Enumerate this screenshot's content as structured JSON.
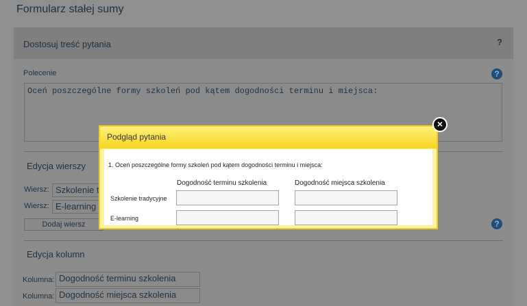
{
  "page": {
    "title": "Formularz stałej sumy"
  },
  "panel": {
    "header_title": "Dostosuj treść pytania",
    "header_help": "?",
    "polecenie_label": "Polecenie",
    "help_icon": "?",
    "polecenie_value": "Oceń poszczególne formy szkoleń pod kątem dogodności terminu i miejsca:"
  },
  "rows_section": {
    "title": "Edycja wierszy",
    "row_label": "Wiersz:",
    "rows": [
      "Szkolenie tradycyjne",
      "E-learning"
    ],
    "add_button": "Dodaj wiersz"
  },
  "columns_section": {
    "title": "Edycja kolumn",
    "column_label": "Kolumna:",
    "columns": [
      "Dogodność terminu szkolenia",
      "Dogodność miejsca szkolenia"
    ]
  },
  "modal": {
    "title": "Podgląd pytania",
    "question": "1. Oceń poszczególne formy szkoleń pod kątem dogodności terminu i miejsca:",
    "col_headers": [
      "Dogodność terminu szkolenia",
      "Dogodność miejsca szkolenia"
    ],
    "rows": [
      "Szkolenie tradycyjne",
      "E-learning"
    ],
    "close_icon": "close-icon"
  }
}
